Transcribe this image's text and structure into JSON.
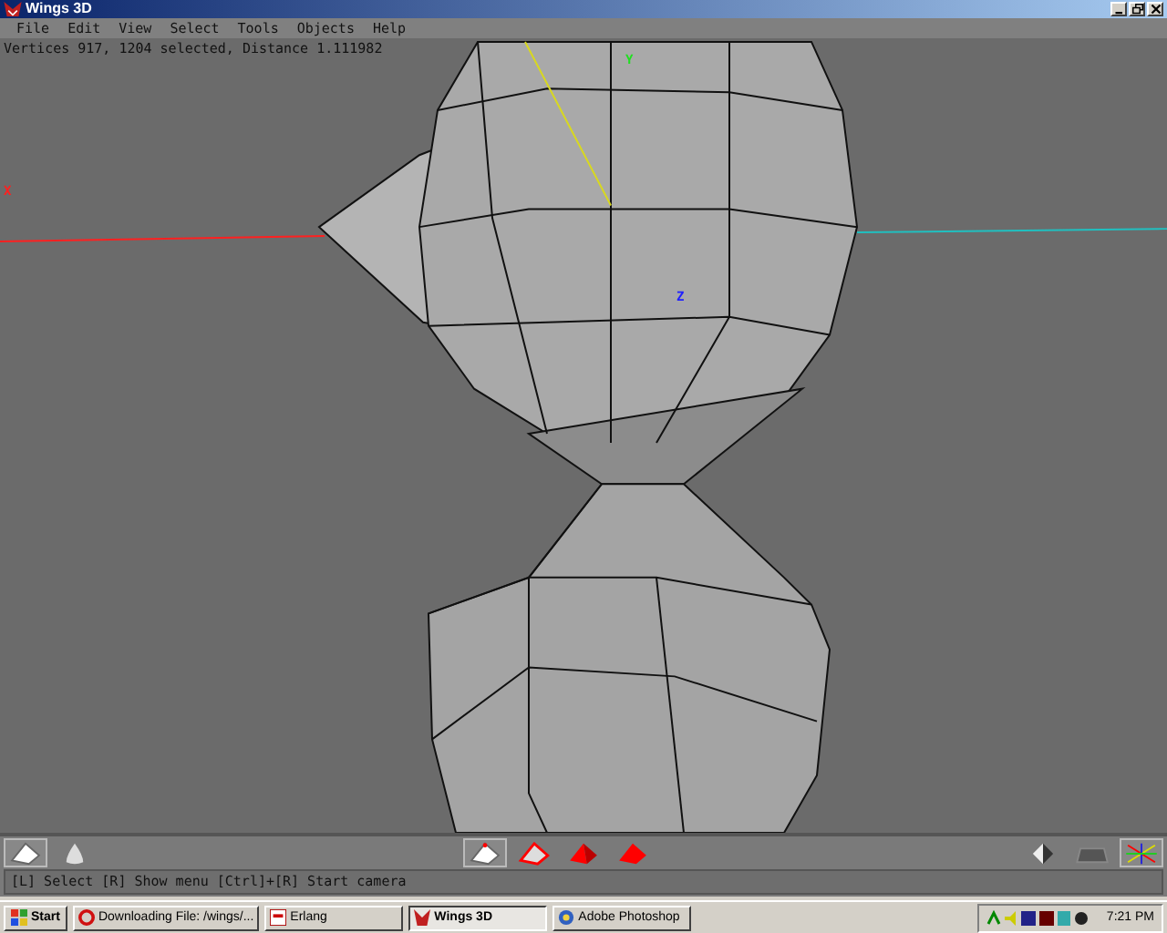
{
  "window": {
    "title": "Wings 3D"
  },
  "menu": [
    "File",
    "Edit",
    "View",
    "Select",
    "Tools",
    "Objects",
    "Help"
  ],
  "info": "Vertices 917, 1204 selected, Distance 1.111982",
  "axes": [
    {
      "label": "X",
      "color": "#ff2020"
    },
    {
      "label": "Y",
      "color": "#20e020"
    },
    {
      "label": "Z",
      "color": "#2020ff"
    }
  ],
  "workmode_buttons": [
    {
      "kind": "flat",
      "selected": true
    },
    {
      "kind": "smooth",
      "selected": false
    }
  ],
  "select_modes": [
    {
      "kind": "vertex",
      "selected": true
    },
    {
      "kind": "edge",
      "selected": false
    },
    {
      "kind": "face",
      "selected": false
    },
    {
      "kind": "body",
      "selected": false
    }
  ],
  "view_buttons": [
    {
      "kind": "perspective",
      "selected": false
    },
    {
      "kind": "groundplane",
      "selected": false
    },
    {
      "kind": "axes",
      "selected": true
    }
  ],
  "hint": "[L] Select  [R] Show menu  [Ctrl]+[R] Start camera",
  "taskbar": {
    "start": "Start",
    "tasks": [
      {
        "label": "Downloading File: /wings/...",
        "kind": "browser",
        "selected": false
      },
      {
        "label": "Erlang",
        "kind": "erlang",
        "selected": false
      },
      {
        "label": "Wings 3D",
        "kind": "wings",
        "selected": true
      },
      {
        "label": "Adobe Photoshop",
        "kind": "photoshop",
        "selected": false
      }
    ],
    "clock": "7:21 PM"
  }
}
